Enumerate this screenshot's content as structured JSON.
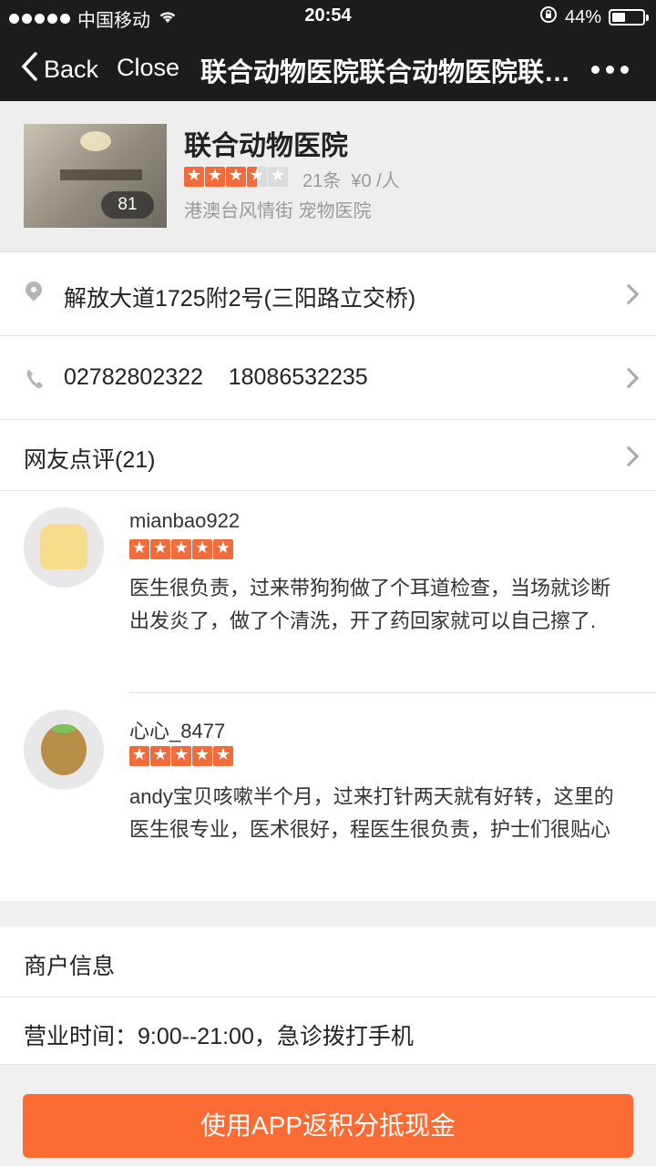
{
  "status_bar": {
    "carrier": "中国移动",
    "time": "20:54",
    "battery": "44%",
    "battery_level": 0.44
  },
  "nav": {
    "back_label": "Back",
    "close_label": "Close",
    "title": "联合动物医院联合动物医院联合动物医院",
    "more_icon": "more-dots-icon"
  },
  "shop": {
    "name": "联合动物医院",
    "photo_count": "81",
    "rating": 3.5,
    "review_count": "21条",
    "price": "¥0 /人",
    "category": "港澳台风情街 宠物医院"
  },
  "address": "解放大道1725附2号(三阳路立交桥)",
  "phones": "02782802322    18086532235",
  "reviews": {
    "title": "网友点评(21)",
    "items": [
      {
        "user": "mianbao922",
        "rating": 5,
        "avatar": "toast-avatar",
        "text": "医生很负责，过来带狗狗做了个耳道检查，当场就诊断出发炎了，做了个清洗，开了药回家就可以自己擦了."
      },
      {
        "user": "心心_8477",
        "rating": 5,
        "avatar": "kiwi-avatar",
        "text": "andy宝贝咳嗽半个月，过来打针两天就有好转，这里的医生很专业，医术很好，程医生很负责，护士们很贴心"
      }
    ]
  },
  "merchant": {
    "title": "商户信息",
    "hours": "营业时间：9:00--21:00，急诊拨打手机"
  },
  "cta": {
    "label": "使用APP返积分抵现金"
  },
  "colors": {
    "accent": "#fb6b33",
    "star": "#f26b3a",
    "nav_bg": "#1c1c1e"
  }
}
